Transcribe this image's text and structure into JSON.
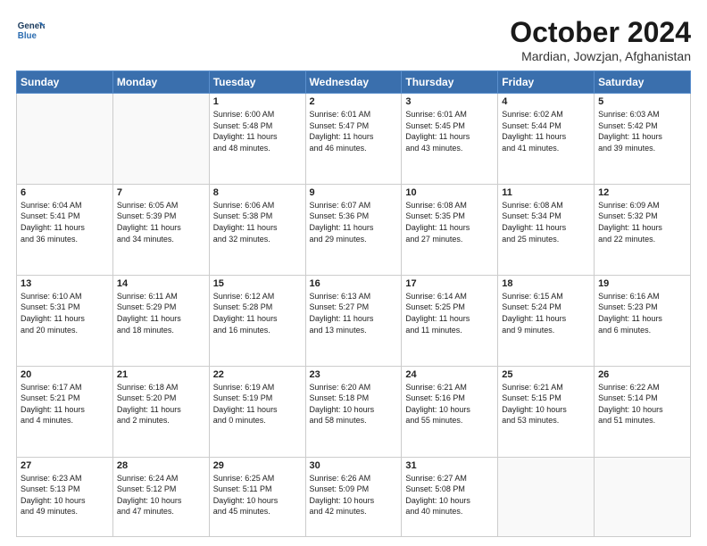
{
  "header": {
    "logo_line1": "General",
    "logo_line2": "Blue",
    "month": "October 2024",
    "location": "Mardian, Jowzjan, Afghanistan"
  },
  "days_of_week": [
    "Sunday",
    "Monday",
    "Tuesday",
    "Wednesday",
    "Thursday",
    "Friday",
    "Saturday"
  ],
  "weeks": [
    [
      {
        "day": "",
        "info": ""
      },
      {
        "day": "",
        "info": ""
      },
      {
        "day": "1",
        "info": "Sunrise: 6:00 AM\nSunset: 5:48 PM\nDaylight: 11 hours\nand 48 minutes."
      },
      {
        "day": "2",
        "info": "Sunrise: 6:01 AM\nSunset: 5:47 PM\nDaylight: 11 hours\nand 46 minutes."
      },
      {
        "day": "3",
        "info": "Sunrise: 6:01 AM\nSunset: 5:45 PM\nDaylight: 11 hours\nand 43 minutes."
      },
      {
        "day": "4",
        "info": "Sunrise: 6:02 AM\nSunset: 5:44 PM\nDaylight: 11 hours\nand 41 minutes."
      },
      {
        "day": "5",
        "info": "Sunrise: 6:03 AM\nSunset: 5:42 PM\nDaylight: 11 hours\nand 39 minutes."
      }
    ],
    [
      {
        "day": "6",
        "info": "Sunrise: 6:04 AM\nSunset: 5:41 PM\nDaylight: 11 hours\nand 36 minutes."
      },
      {
        "day": "7",
        "info": "Sunrise: 6:05 AM\nSunset: 5:39 PM\nDaylight: 11 hours\nand 34 minutes."
      },
      {
        "day": "8",
        "info": "Sunrise: 6:06 AM\nSunset: 5:38 PM\nDaylight: 11 hours\nand 32 minutes."
      },
      {
        "day": "9",
        "info": "Sunrise: 6:07 AM\nSunset: 5:36 PM\nDaylight: 11 hours\nand 29 minutes."
      },
      {
        "day": "10",
        "info": "Sunrise: 6:08 AM\nSunset: 5:35 PM\nDaylight: 11 hours\nand 27 minutes."
      },
      {
        "day": "11",
        "info": "Sunrise: 6:08 AM\nSunset: 5:34 PM\nDaylight: 11 hours\nand 25 minutes."
      },
      {
        "day": "12",
        "info": "Sunrise: 6:09 AM\nSunset: 5:32 PM\nDaylight: 11 hours\nand 22 minutes."
      }
    ],
    [
      {
        "day": "13",
        "info": "Sunrise: 6:10 AM\nSunset: 5:31 PM\nDaylight: 11 hours\nand 20 minutes."
      },
      {
        "day": "14",
        "info": "Sunrise: 6:11 AM\nSunset: 5:29 PM\nDaylight: 11 hours\nand 18 minutes."
      },
      {
        "day": "15",
        "info": "Sunrise: 6:12 AM\nSunset: 5:28 PM\nDaylight: 11 hours\nand 16 minutes."
      },
      {
        "day": "16",
        "info": "Sunrise: 6:13 AM\nSunset: 5:27 PM\nDaylight: 11 hours\nand 13 minutes."
      },
      {
        "day": "17",
        "info": "Sunrise: 6:14 AM\nSunset: 5:25 PM\nDaylight: 11 hours\nand 11 minutes."
      },
      {
        "day": "18",
        "info": "Sunrise: 6:15 AM\nSunset: 5:24 PM\nDaylight: 11 hours\nand 9 minutes."
      },
      {
        "day": "19",
        "info": "Sunrise: 6:16 AM\nSunset: 5:23 PM\nDaylight: 11 hours\nand 6 minutes."
      }
    ],
    [
      {
        "day": "20",
        "info": "Sunrise: 6:17 AM\nSunset: 5:21 PM\nDaylight: 11 hours\nand 4 minutes."
      },
      {
        "day": "21",
        "info": "Sunrise: 6:18 AM\nSunset: 5:20 PM\nDaylight: 11 hours\nand 2 minutes."
      },
      {
        "day": "22",
        "info": "Sunrise: 6:19 AM\nSunset: 5:19 PM\nDaylight: 11 hours\nand 0 minutes."
      },
      {
        "day": "23",
        "info": "Sunrise: 6:20 AM\nSunset: 5:18 PM\nDaylight: 10 hours\nand 58 minutes."
      },
      {
        "day": "24",
        "info": "Sunrise: 6:21 AM\nSunset: 5:16 PM\nDaylight: 10 hours\nand 55 minutes."
      },
      {
        "day": "25",
        "info": "Sunrise: 6:21 AM\nSunset: 5:15 PM\nDaylight: 10 hours\nand 53 minutes."
      },
      {
        "day": "26",
        "info": "Sunrise: 6:22 AM\nSunset: 5:14 PM\nDaylight: 10 hours\nand 51 minutes."
      }
    ],
    [
      {
        "day": "27",
        "info": "Sunrise: 6:23 AM\nSunset: 5:13 PM\nDaylight: 10 hours\nand 49 minutes."
      },
      {
        "day": "28",
        "info": "Sunrise: 6:24 AM\nSunset: 5:12 PM\nDaylight: 10 hours\nand 47 minutes."
      },
      {
        "day": "29",
        "info": "Sunrise: 6:25 AM\nSunset: 5:11 PM\nDaylight: 10 hours\nand 45 minutes."
      },
      {
        "day": "30",
        "info": "Sunrise: 6:26 AM\nSunset: 5:09 PM\nDaylight: 10 hours\nand 42 minutes."
      },
      {
        "day": "31",
        "info": "Sunrise: 6:27 AM\nSunset: 5:08 PM\nDaylight: 10 hours\nand 40 minutes."
      },
      {
        "day": "",
        "info": ""
      },
      {
        "day": "",
        "info": ""
      }
    ]
  ]
}
